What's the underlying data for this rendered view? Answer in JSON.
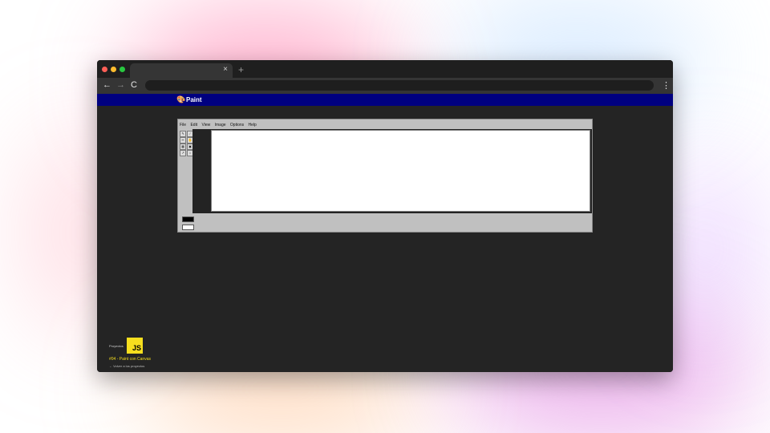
{
  "browser": {
    "tab": {
      "close_glyph": "×"
    },
    "new_tab_glyph": "+",
    "url": "",
    "nav": {
      "back": "←",
      "forward": "→",
      "reload": "C"
    },
    "menu_glyph": "⋮"
  },
  "app": {
    "title": "Paint",
    "logo_icon": "palette-icon",
    "menubar": [
      "File",
      "Edit",
      "View",
      "Image",
      "Options",
      "Help"
    ],
    "tools": [
      "✎",
      "⟋",
      "✂",
      "✋",
      "▦",
      "▣",
      "↗",
      "○"
    ],
    "colors": {
      "primary": "#000000",
      "secondary": "#ffffff"
    }
  },
  "badge": {
    "label": "Proyectos",
    "logo": "JS"
  },
  "project_title": "#04 - Paint con Canvas",
  "back_link": "← Volver a los proyectos"
}
